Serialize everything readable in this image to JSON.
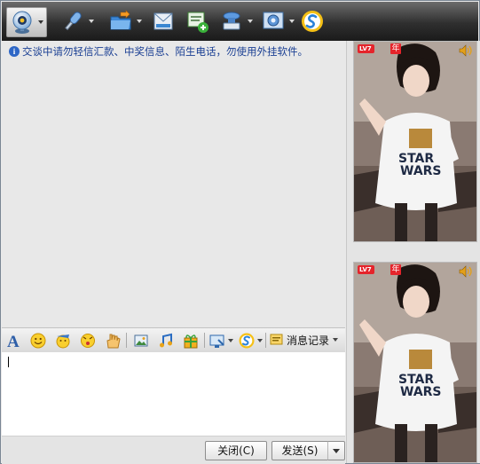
{
  "toolbar": {
    "buttons": [
      {
        "name": "video-call",
        "icon": "webcam-icon",
        "dropdown": true
      },
      {
        "name": "voice-call",
        "icon": "microphone-icon",
        "dropdown": true
      },
      {
        "name": "send-file",
        "icon": "folder-icon",
        "dropdown": true
      },
      {
        "name": "send-sms",
        "icon": "envelope-icon"
      },
      {
        "name": "create-group",
        "icon": "group-add-icon"
      },
      {
        "name": "app",
        "icon": "stamp-icon",
        "dropdown": true
      },
      {
        "name": "settings",
        "icon": "gear-icon",
        "dropdown": true
      },
      {
        "name": "soso",
        "icon": "soso-icon"
      }
    ]
  },
  "history": {
    "notice": "交谈中请勿轻信汇款、中奖信息、陌生电话，勿使用外挂软件。"
  },
  "format_bar": {
    "message_history_label": "消息记录"
  },
  "input": {
    "value": ""
  },
  "actions": {
    "close_label": "关闭(C)",
    "send_label": "发送(S)"
  },
  "side_panel": {
    "show_badge_level": "LV7",
    "show_badge_year": "年"
  },
  "colors": {
    "notice_text": "#1a3f93",
    "badge_red": "#e5242b"
  }
}
